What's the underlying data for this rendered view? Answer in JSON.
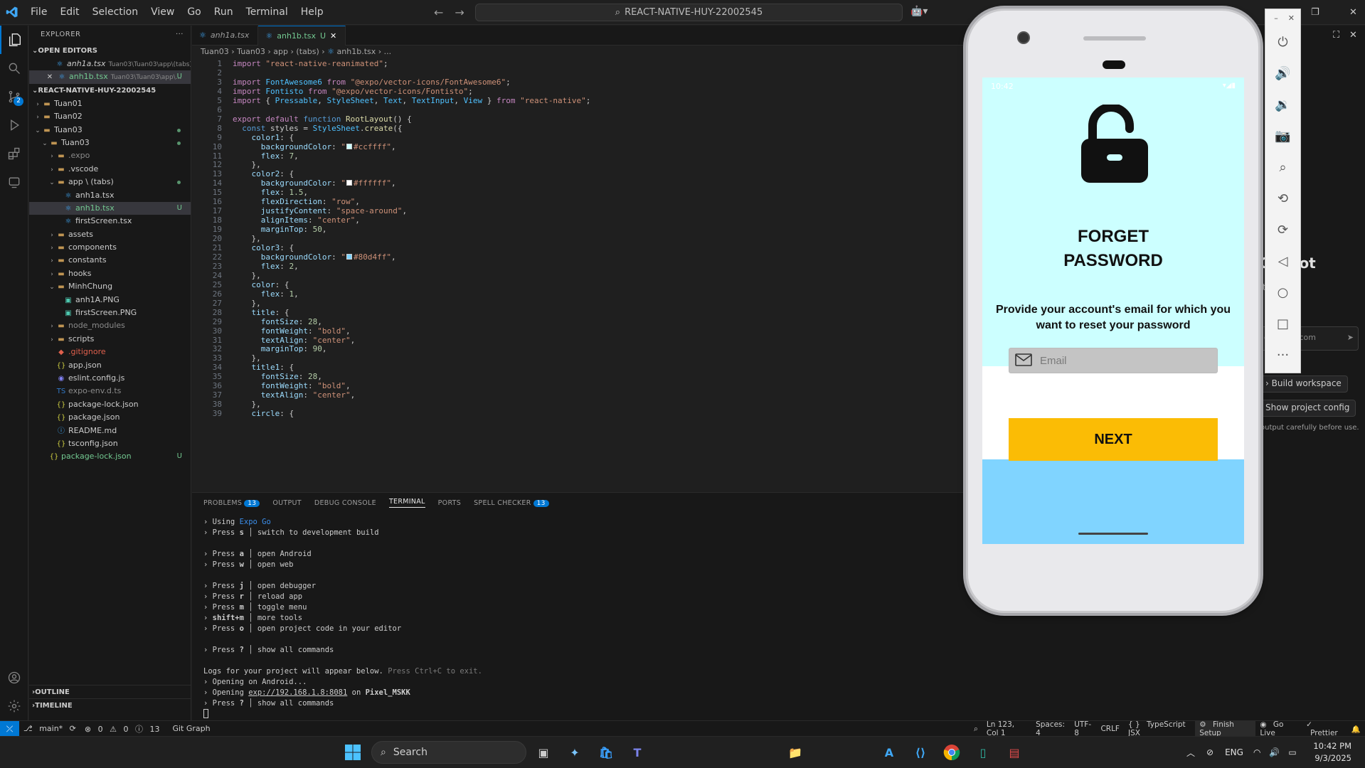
{
  "titlebar": {
    "menu": [
      "File",
      "Edit",
      "Selection",
      "View",
      "Go",
      "Run",
      "Terminal",
      "Help"
    ],
    "command_center": "REACT-NATIVE-HUY-22002545"
  },
  "activity": {
    "scm_badge": "2"
  },
  "explorer": {
    "header": "EXPLORER",
    "open_editors_label": "OPEN EDITORS",
    "open_editors": [
      {
        "name": "anh1a.tsx",
        "path": "Tuan03\\Tuan03\\app\\(tabs)"
      },
      {
        "name": "anh1b.tsx",
        "path": "Tuan03\\Tuan03\\app\\...",
        "status": "U"
      }
    ],
    "project_label": "REACT-NATIVE-HUY-22002545",
    "tree": [
      {
        "name": "Tuan01",
        "indent": 1,
        "type": "folder",
        "open": false
      },
      {
        "name": "Tuan02",
        "indent": 1,
        "type": "folder",
        "open": false
      },
      {
        "name": "Tuan03",
        "indent": 1,
        "type": "folder",
        "open": true,
        "mod": true
      },
      {
        "name": "Tuan03",
        "indent": 2,
        "type": "folder",
        "open": true,
        "mod": true
      },
      {
        "name": ".expo",
        "indent": 3,
        "type": "folder",
        "open": false,
        "dim": true
      },
      {
        "name": ".vscode",
        "indent": 3,
        "type": "folder",
        "open": false
      },
      {
        "name": "app \\ (tabs)",
        "indent": 3,
        "type": "folder",
        "open": true,
        "mod": true
      },
      {
        "name": "anh1a.tsx",
        "indent": 4,
        "type": "tsx"
      },
      {
        "name": "anh1b.tsx",
        "indent": 4,
        "type": "tsx",
        "status": "U",
        "selected": true
      },
      {
        "name": "firstScreen.tsx",
        "indent": 4,
        "type": "tsx"
      },
      {
        "name": "assets",
        "indent": 3,
        "type": "folder",
        "open": false
      },
      {
        "name": "components",
        "indent": 3,
        "type": "folder",
        "open": false
      },
      {
        "name": "constants",
        "indent": 3,
        "type": "folder",
        "open": false
      },
      {
        "name": "hooks",
        "indent": 3,
        "type": "folder",
        "open": false
      },
      {
        "name": "MinhChung",
        "indent": 3,
        "type": "folder",
        "open": true
      },
      {
        "name": "anh1A.PNG",
        "indent": 4,
        "type": "img"
      },
      {
        "name": "firstScreen.PNG",
        "indent": 4,
        "type": "img"
      },
      {
        "name": "node_modules",
        "indent": 3,
        "type": "folder",
        "open": false,
        "dim": true
      },
      {
        "name": "scripts",
        "indent": 3,
        "type": "folder",
        "open": false
      },
      {
        "name": ".gitignore",
        "indent": 3,
        "type": "git"
      },
      {
        "name": "app.json",
        "indent": 3,
        "type": "json"
      },
      {
        "name": "eslint.config.js",
        "indent": 3,
        "type": "eslint"
      },
      {
        "name": "expo-env.d.ts",
        "indent": 3,
        "type": "ts",
        "dim": true
      },
      {
        "name": "package-lock.json",
        "indent": 3,
        "type": "json"
      },
      {
        "name": "package.json",
        "indent": 3,
        "type": "json"
      },
      {
        "name": "README.md",
        "indent": 3,
        "type": "info"
      },
      {
        "name": "tsconfig.json",
        "indent": 3,
        "type": "json"
      },
      {
        "name": "package-lock.json",
        "indent": 2,
        "type": "json",
        "status": "U",
        "mod": true
      }
    ],
    "outline": "OUTLINE",
    "timeline": "TIMELINE"
  },
  "tabs": [
    {
      "label": "anh1a.tsx"
    },
    {
      "label": "anh1b.tsx",
      "status": "U",
      "active": true
    }
  ],
  "breadcrumb": [
    "Tuan03",
    "Tuan03",
    "app",
    "(tabs)",
    "anh1b.tsx",
    "..."
  ],
  "code": [
    "import \"react-native-reanimated\";",
    "",
    "import FontAwesome6 from \"@expo/vector-icons/FontAwesome6\";",
    "import Fontisto from \"@expo/vector-icons/Fontisto\";",
    "import { Pressable, StyleSheet, Text, TextInput, View } from \"react-native\";",
    "",
    "export default function RootLayout() {",
    "  const styles = StyleSheet.create({",
    "    color1: {",
    "      backgroundColor: \"#ccffff\",",
    "      flex: 7,",
    "    },",
    "    color2: {",
    "      backgroundColor: \"#ffffff\",",
    "      flex: 1.5,",
    "      flexDirection: \"row\",",
    "      justifyContent: \"space-around\",",
    "      alignItems: \"center\",",
    "      marginTop: 50,",
    "    },",
    "    color3: {",
    "      backgroundColor: \"#80d4ff\",",
    "      flex: 2,",
    "    },",
    "    color: {",
    "      flex: 1,",
    "    },",
    "    title: {",
    "      fontSize: 28,",
    "      fontWeight: \"bold\",",
    "      textAlign: \"center\",",
    "      marginTop: 90,",
    "    },",
    "    title1: {",
    "      fontSize: 28,",
    "      fontWeight: \"bold\",",
    "      textAlign: \"center\",",
    "    },",
    "    circle: {"
  ],
  "panel": {
    "tabs": [
      "PROBLEMS",
      "OUTPUT",
      "DEBUG CONSOLE",
      "TERMINAL",
      "PORTS",
      "SPELL CHECKER"
    ],
    "problems_count": "13",
    "spell_count": "13",
    "terminal": [
      {
        "a": "› Using ",
        "b": "Expo Go",
        "c": ""
      },
      {
        "a": "› Press ",
        "b": "s",
        "c": " │ switch to development build"
      },
      {
        "a": "",
        "b": "",
        "c": ""
      },
      {
        "a": "› Press ",
        "b": "a",
        "c": " │ open Android"
      },
      {
        "a": "› Press ",
        "b": "w",
        "c": " │ open web"
      },
      {
        "a": "",
        "b": "",
        "c": ""
      },
      {
        "a": "› Press ",
        "b": "j",
        "c": " │ open debugger"
      },
      {
        "a": "› Press ",
        "b": "r",
        "c": " │ reload app"
      },
      {
        "a": "› Press ",
        "b": "m",
        "c": " │ toggle menu"
      },
      {
        "a": "› ",
        "b": "shift+m",
        "c": " │ more tools"
      },
      {
        "a": "› Press ",
        "b": "o",
        "c": " │ open project code in your editor"
      },
      {
        "a": "",
        "b": "",
        "c": ""
      },
      {
        "a": "› Press ",
        "b": "?",
        "c": " │ show all commands"
      },
      {
        "a": "",
        "b": "",
        "c": ""
      },
      {
        "a": "Logs for your project will appear below. ",
        "b": "Press Ctrl+C to exit.",
        "c": ""
      },
      {
        "a": "› Opening on Android...",
        "b": "",
        "c": ""
      },
      {
        "a": "› Opening ",
        "b": "exp://192.168.1.8:8081",
        "c": " on Pixel_MSKK"
      },
      {
        "a": "› Press ",
        "b": "?",
        "c": " │ show all commands"
      }
    ]
  },
  "rightpanel": {
    "title": "Copilot",
    "line2": "ted",
    "input_placeholder": "ons (@), com",
    "build_workspace": "Build workspace",
    "show_config": "Show project config",
    "note": "output carefully before use."
  },
  "phone": {
    "status_time": "10:42",
    "title_line1": "FORGET",
    "title_line2": "PASSWORD",
    "description": "Provide your account's email for which you want to reset your password",
    "email_placeholder": "Email",
    "next_label": "NEXT",
    "colors": {
      "top": "#ccffff",
      "middle": "#ffffff",
      "bottom": "#80d4ff",
      "button": "#fbbc05"
    }
  },
  "statusbar": {
    "branch": "main*",
    "errors": "0",
    "warnings": "0",
    "infos": "13",
    "git_graph": "Git Graph",
    "position": "Ln 123, Col 1",
    "spaces": "Spaces: 4",
    "encoding": "UTF-8",
    "eol": "CRLF",
    "language": "TypeScript JSX",
    "finish_setup": "Finish Setup",
    "go_live": "Go Live",
    "prettier": "Prettier"
  },
  "taskbar": {
    "search": "Search",
    "lang": "ENG",
    "time": "10:42 PM",
    "date": "9/3/2025"
  }
}
